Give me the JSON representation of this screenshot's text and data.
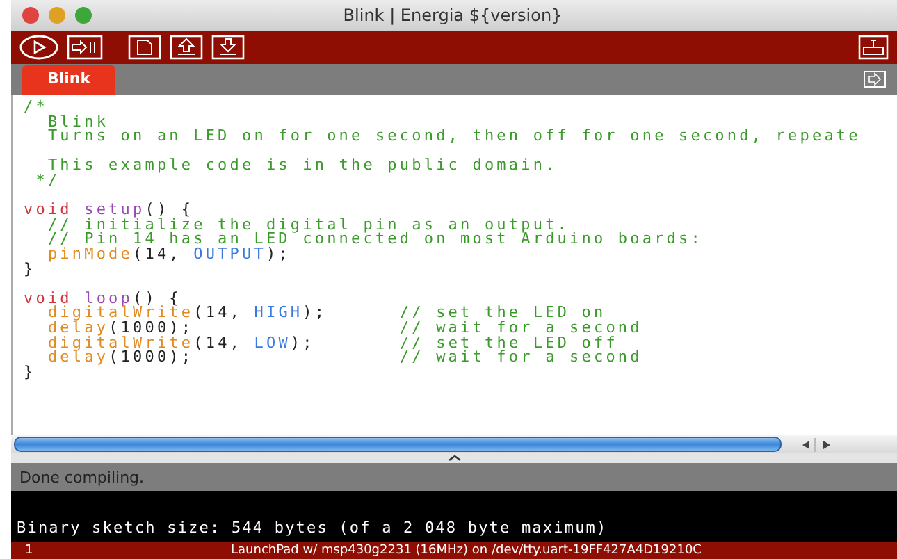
{
  "window": {
    "title": "Blink | Energia ${version}"
  },
  "tabs": [
    {
      "label": "Blink",
      "selected": true
    }
  ],
  "editor": {
    "lines": [
      {
        "tokens": [
          {
            "t": "/*",
            "kind": "comment"
          }
        ]
      },
      {
        "tokens": [
          {
            "t": "  Blink",
            "kind": "comment"
          }
        ]
      },
      {
        "tokens": [
          {
            "t": "  Turns on an LED on for one second, then off for one second, repeate",
            "kind": "comment"
          }
        ]
      },
      {
        "gap_before": true,
        "tokens": [
          {
            "t": "  This example code is in the public domain.",
            "kind": "comment"
          }
        ]
      },
      {
        "tokens": [
          {
            "t": " */",
            "kind": "comment"
          }
        ]
      },
      {
        "gap_before": true,
        "tokens": [
          {
            "t": "void",
            "kind": "keyword"
          },
          {
            "t": " setup",
            "kind": "function"
          },
          {
            "t": "() {",
            "kind": "plain"
          }
        ]
      },
      {
        "tokens": [
          {
            "t": "  // initialize the digital pin as an output.",
            "kind": "comment"
          }
        ]
      },
      {
        "tokens": [
          {
            "t": "  // Pin 14 has an LED connected on most Arduino boards:",
            "kind": "comment"
          }
        ]
      },
      {
        "tokens": [
          {
            "t": "  pinMode",
            "kind": "builtin"
          },
          {
            "t": "(14, ",
            "kind": "plain"
          },
          {
            "t": "OUTPUT",
            "kind": "constant"
          },
          {
            "t": ");",
            "kind": "plain"
          }
        ]
      },
      {
        "tokens": [
          {
            "t": "}",
            "kind": "plain"
          }
        ]
      },
      {
        "gap_before": true,
        "tokens": [
          {
            "t": "void",
            "kind": "keyword"
          },
          {
            "t": " loop",
            "kind": "function"
          },
          {
            "t": "() {",
            "kind": "plain"
          }
        ]
      },
      {
        "tokens": [
          {
            "t": "  digitalWrite",
            "kind": "builtin"
          },
          {
            "t": "(14, ",
            "kind": "plain"
          },
          {
            "t": "HIGH",
            "kind": "constant"
          },
          {
            "t": ");      ",
            "kind": "plain"
          },
          {
            "t": "// set the LED on",
            "kind": "comment"
          }
        ]
      },
      {
        "tokens": [
          {
            "t": "  delay",
            "kind": "builtin"
          },
          {
            "t": "(1000);                 ",
            "kind": "plain"
          },
          {
            "t": "// wait for a second",
            "kind": "comment"
          }
        ]
      },
      {
        "tokens": [
          {
            "t": "  digitalWrite",
            "kind": "builtin"
          },
          {
            "t": "(14, ",
            "kind": "plain"
          },
          {
            "t": "LOW",
            "kind": "constant"
          },
          {
            "t": ");       ",
            "kind": "plain"
          },
          {
            "t": "// set the LED off",
            "kind": "comment"
          }
        ]
      },
      {
        "tokens": [
          {
            "t": "  delay",
            "kind": "builtin"
          },
          {
            "t": "(1000);                 ",
            "kind": "plain"
          },
          {
            "t": "// wait for a second",
            "kind": "comment"
          }
        ]
      },
      {
        "tokens": [
          {
            "t": "}",
            "kind": "plain"
          }
        ]
      }
    ]
  },
  "status": {
    "message": "Done compiling."
  },
  "console": {
    "lines": [
      "Binary sketch size: 544 bytes (of a 2 048 byte maximum)"
    ]
  },
  "footer": {
    "line": "1",
    "board": "LaunchPad w/ msp430g2231 (16MHz) on /dev/tty.uart-19FF427A4D19210C"
  }
}
